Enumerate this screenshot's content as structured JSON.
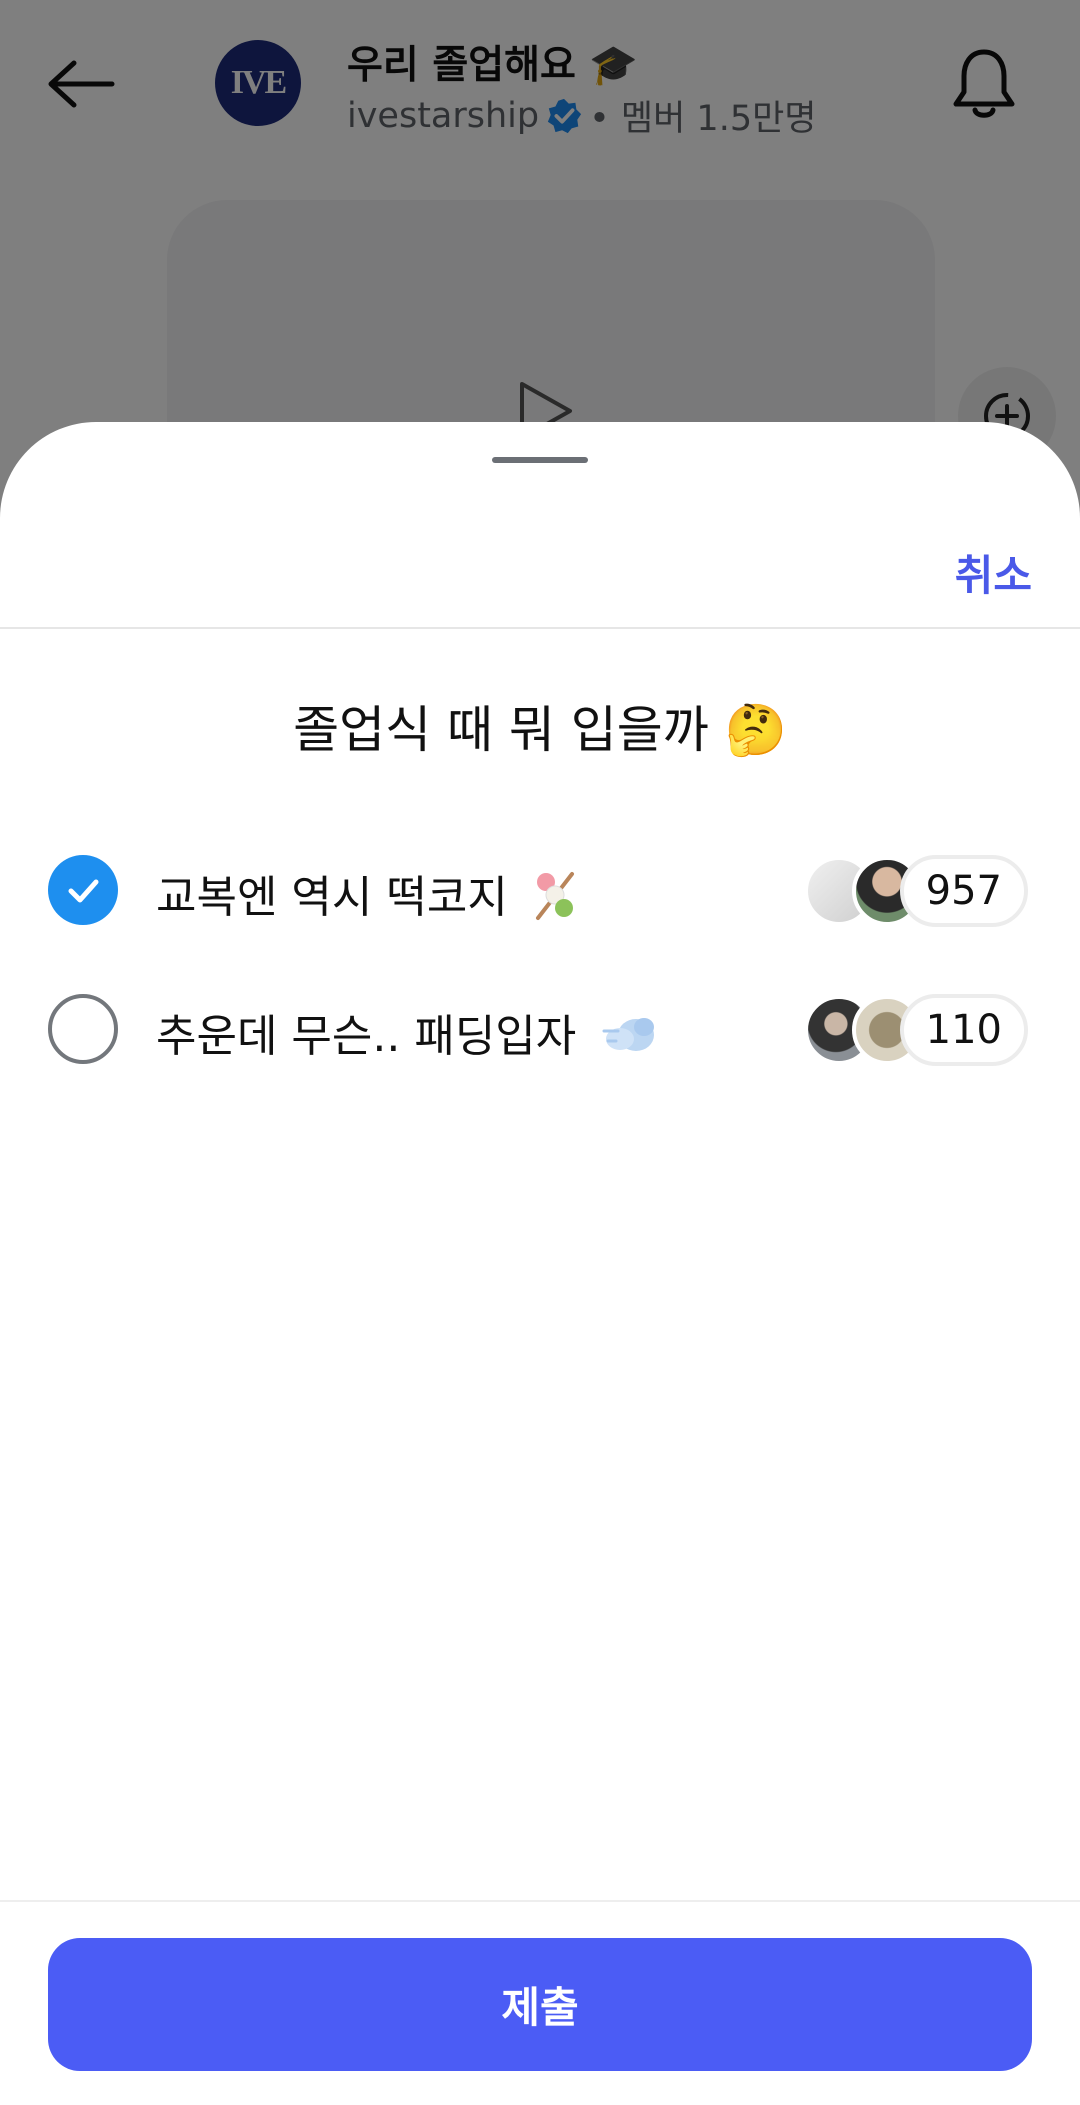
{
  "header": {
    "channel_title": "우리 졸업해요 🎓",
    "channel_handle": "ivestarship",
    "member_info": "• 멤버 1.5만명",
    "avatar_text": "IVE"
  },
  "poll_sheet": {
    "cancel_label": "취소",
    "question": "졸업식 때 뭐 입을까 🤔",
    "options": [
      {
        "label": "교복엔 역시 떡코지",
        "emoji": "🍡",
        "count": "957",
        "selected": true
      },
      {
        "label": "추운데 무슨.. 패딩입자",
        "emoji": "💨",
        "count": "110",
        "selected": false
      }
    ],
    "submit_label": "제출"
  },
  "colors": {
    "accent": "#4b5cf5",
    "cancel_text": "#4a59e8",
    "checked_radio": "#1e8fef"
  }
}
